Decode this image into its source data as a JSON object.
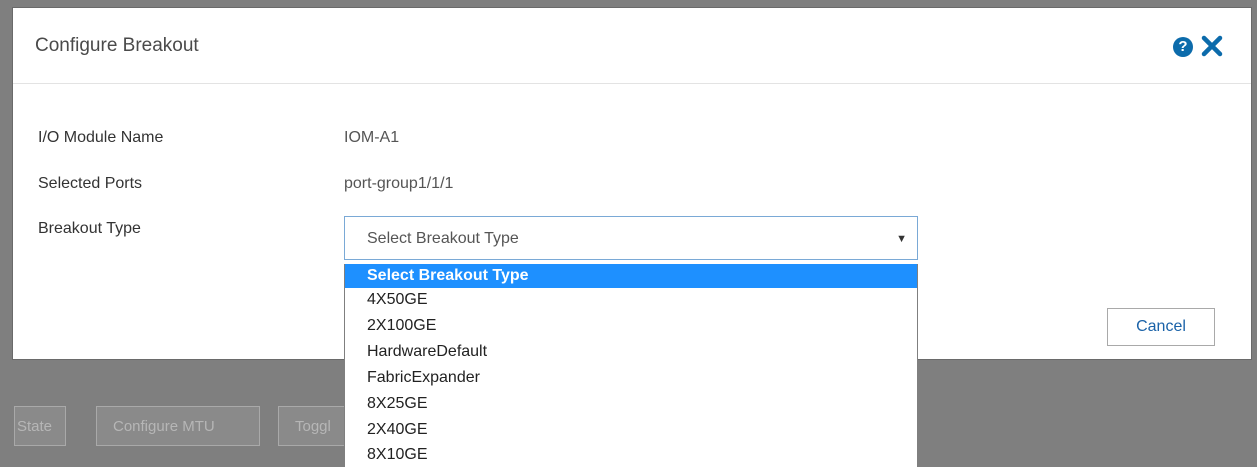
{
  "background": {
    "buttons": [
      "State",
      "Configure MTU",
      "Toggl"
    ]
  },
  "modal": {
    "title": "Configure Breakout",
    "icons": {
      "help": "help-icon",
      "close": "close-icon"
    },
    "fields": [
      {
        "label": "I/O Module Name",
        "value": "IOM-A1"
      },
      {
        "label": "Selected Ports",
        "value": "port-group1/1/1"
      },
      {
        "label": "Breakout Type",
        "value": ""
      }
    ],
    "select": {
      "current": "Select Breakout Type",
      "options": [
        "Select Breakout Type",
        "4X50GE",
        "2X100GE",
        "HardwareDefault",
        "FabricExpander",
        "8X25GE",
        "2X40GE",
        "8X10GE"
      ],
      "highlighted_index": 0
    },
    "cancel_label": "Cancel"
  },
  "colors": {
    "accent": "#1e90ff",
    "icon_blue": "#0c6bab",
    "overlay": "#7f7f7f"
  }
}
